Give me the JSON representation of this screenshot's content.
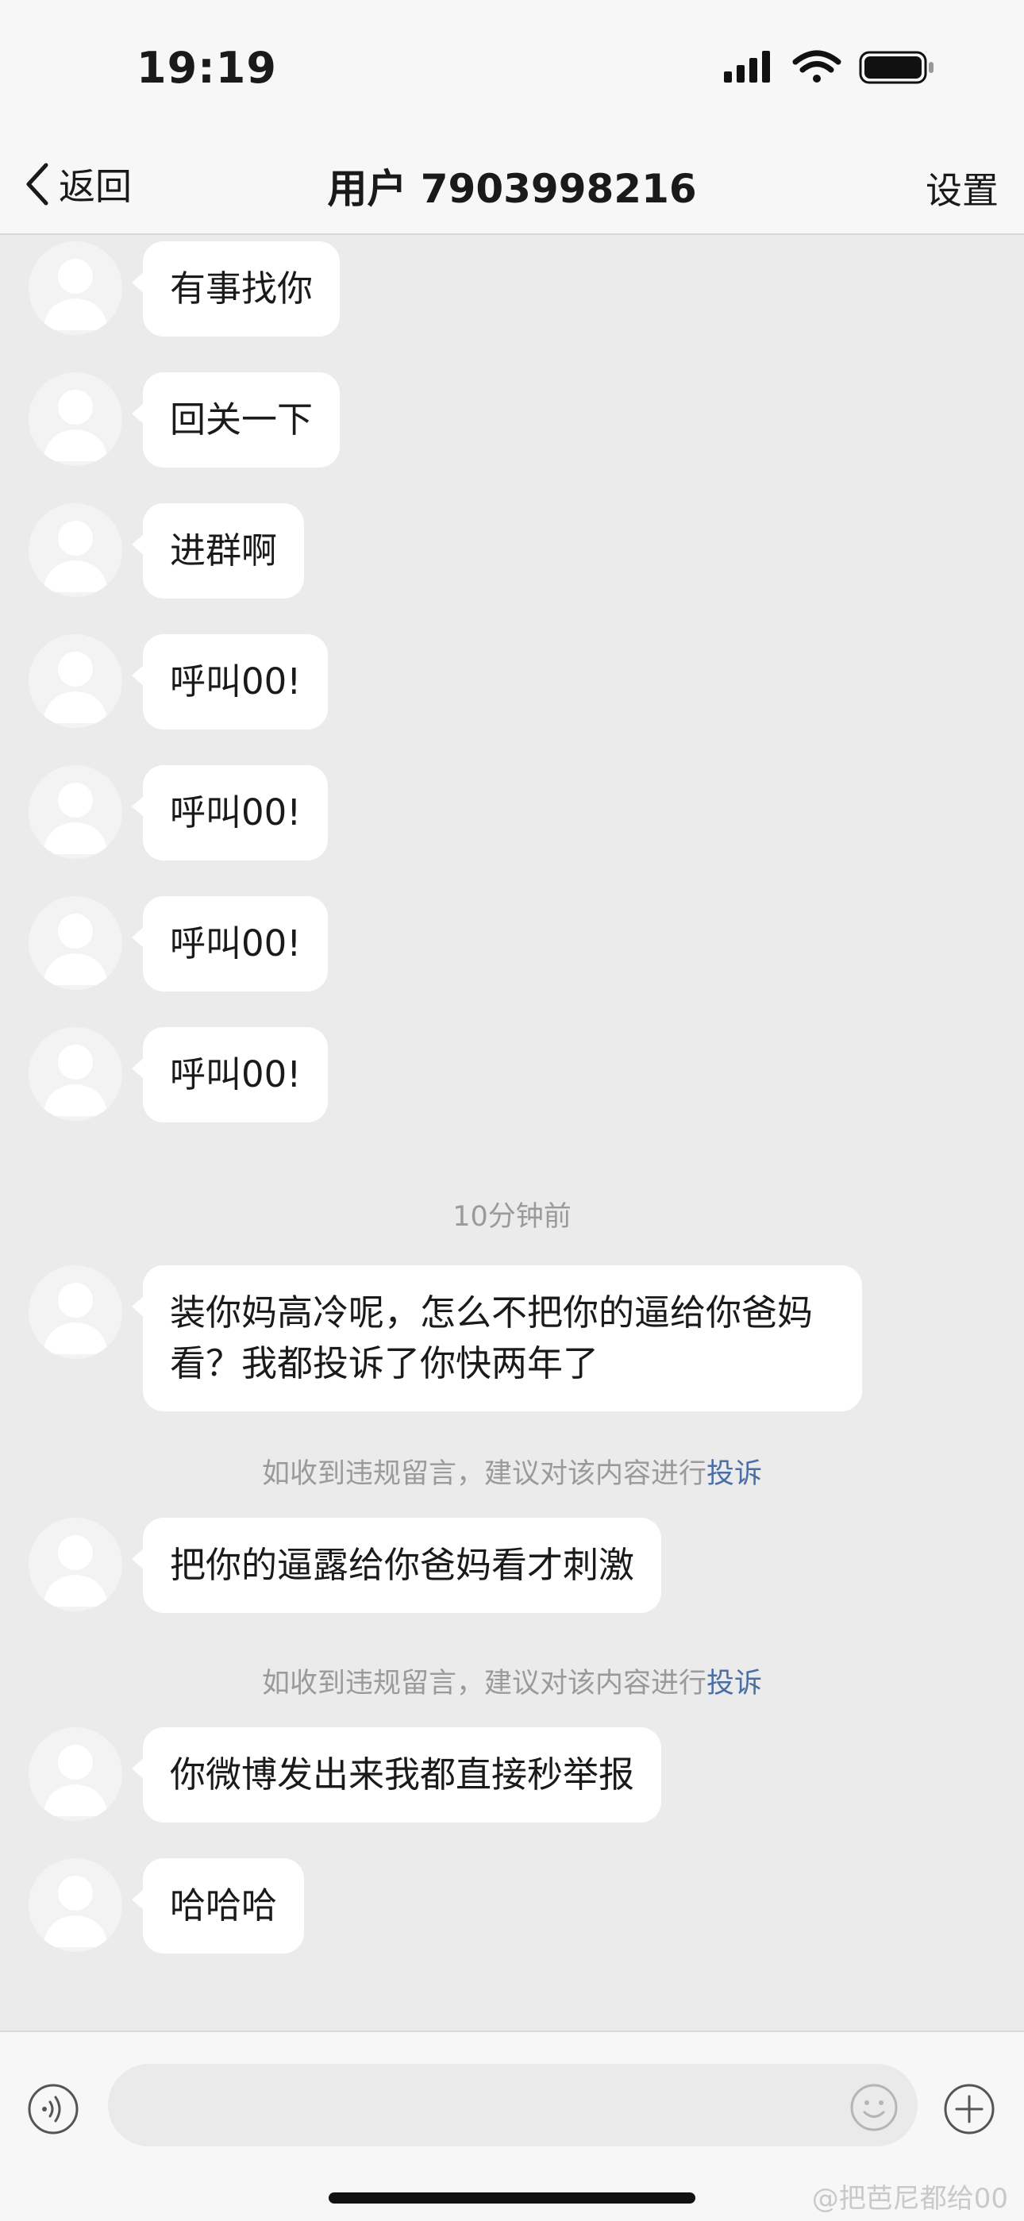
{
  "status_bar": {
    "time": "19:19"
  },
  "nav": {
    "back_label": "返回",
    "title": "用户 7903998216",
    "settings_label": "设置"
  },
  "messages": [
    {
      "text": "有事找你"
    },
    {
      "text": "回关一下"
    },
    {
      "text": "进群啊"
    },
    {
      "text": "呼叫00!"
    },
    {
      "text": "呼叫00!"
    },
    {
      "text": "呼叫00!"
    },
    {
      "text": "呼叫00!"
    },
    {
      "text": "装你妈高冷呢，怎么不把你的逼给你爸妈看？我都投诉了你快两年了"
    },
    {
      "text": "把你的逼露给你爸妈看才刺激"
    },
    {
      "text": "你微博发出来我都直接秒举报"
    },
    {
      "text": "哈哈哈"
    }
  ],
  "timestamp": "10分钟前",
  "notices": [
    {
      "text": "如收到违规留言，建议对该内容进行",
      "link": "投诉"
    },
    {
      "text": "如收到违规留言，建议对该内容进行",
      "link": "投诉"
    }
  ],
  "input": {
    "placeholder": ""
  },
  "watermark": "@把芭尼都给00",
  "colors": {
    "background": "#ebebeb",
    "bubble": "#ffffff",
    "link": "#4a6fa5",
    "muted_text": "#9a9a9a"
  }
}
